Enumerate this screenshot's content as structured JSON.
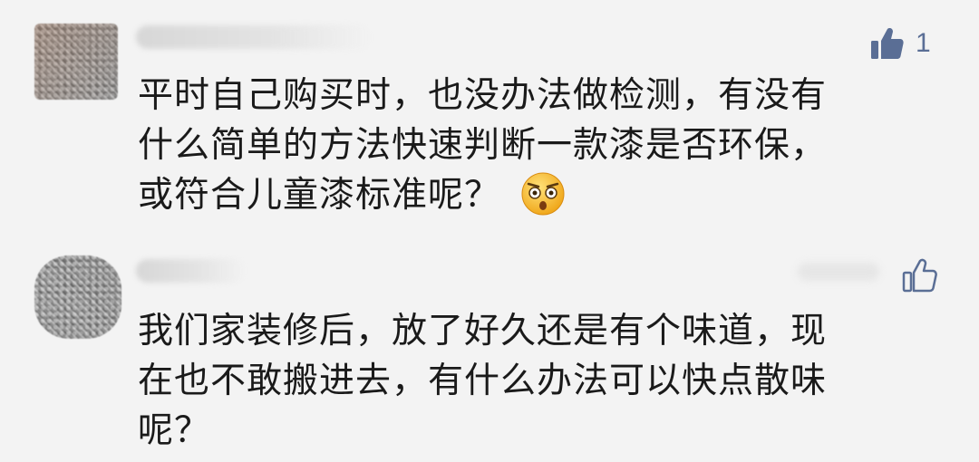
{
  "comments": [
    {
      "lines": [
        "平时自己购买时，也没办法做检测，有没有",
        "什么简单的方法快速判断一款漆是否环保，",
        "或符合儿童漆标准呢？"
      ],
      "emoji": "shocked-face-emoji",
      "like_count": "1",
      "liked": true,
      "accent_color": "#5a6e95"
    },
    {
      "lines": [
        "我们家装修后，放了好久还是有个味道，现",
        "在也不敢搬进去，有什么办法可以快点散味",
        "呢？"
      ],
      "like_count": "",
      "liked": false,
      "accent_color": "#5a6e95"
    }
  ],
  "icons": {
    "like_filled": "thumbs-up-filled-icon",
    "like_outline": "thumbs-up-outline-icon"
  }
}
